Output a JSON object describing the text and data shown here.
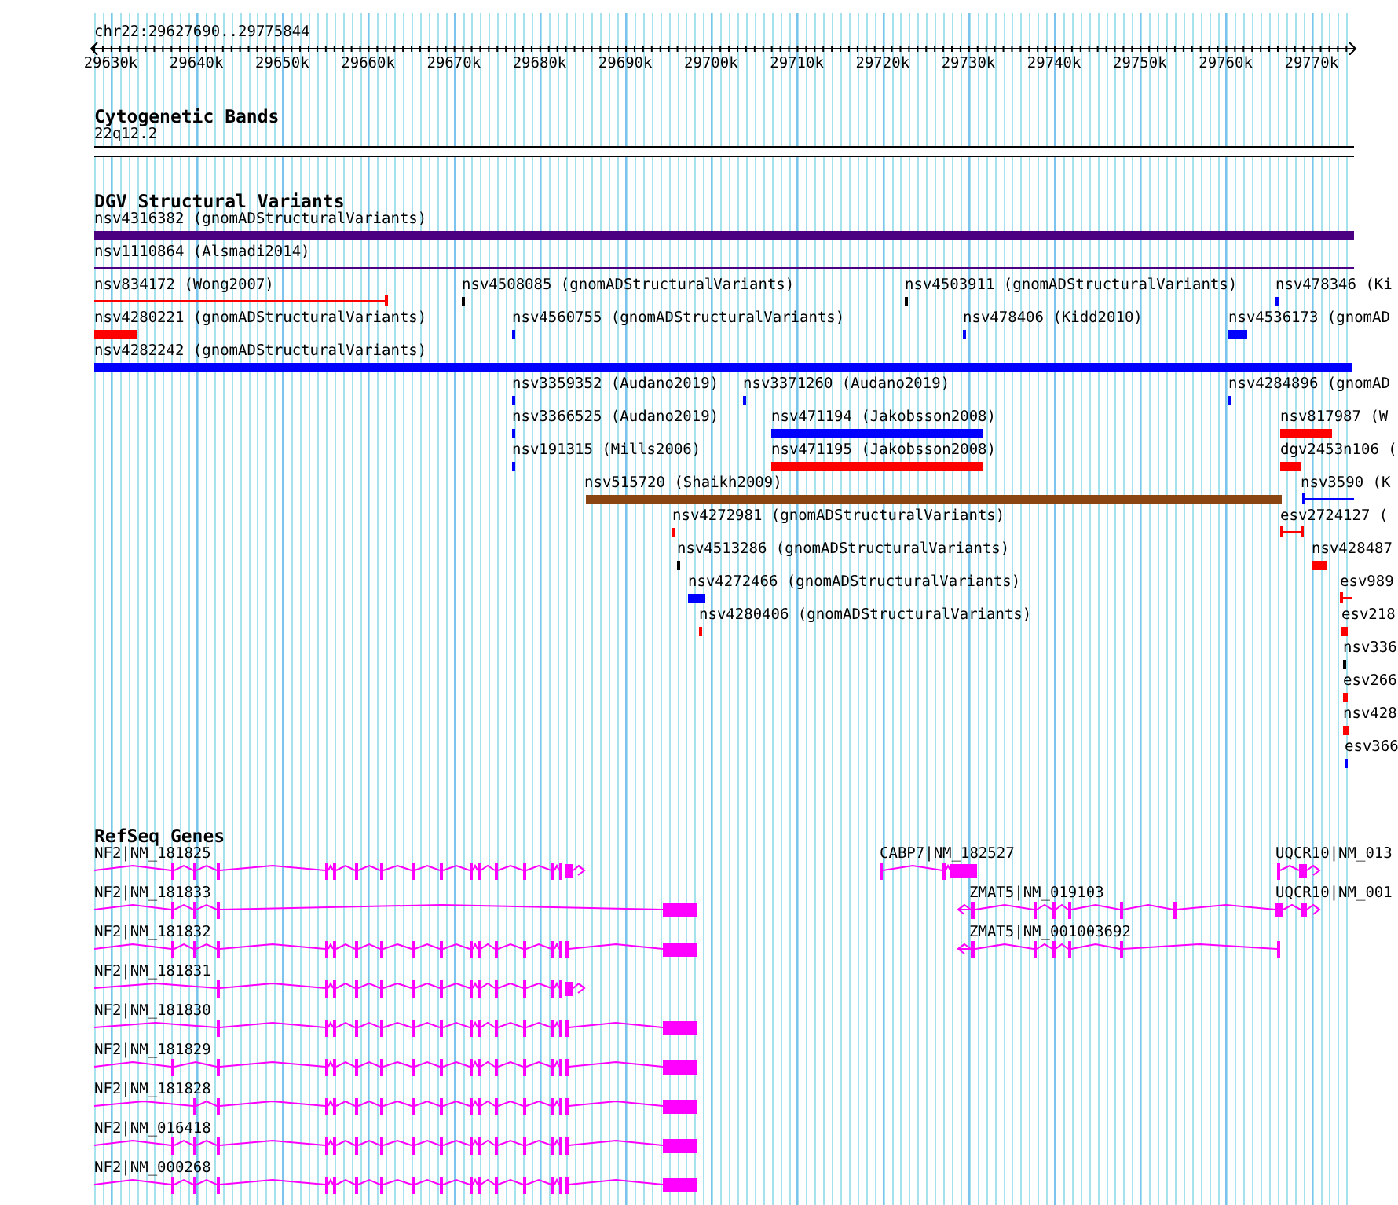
{
  "ruler": {
    "location": "chr22:29627690..29775844",
    "ticks": [
      "29630k",
      "29640k",
      "29650k",
      "29660k",
      "29670k",
      "29680k",
      "29690k",
      "29700k",
      "29710k",
      "29720k",
      "29730k",
      "29740k",
      "29750k",
      "29760k",
      "29770k"
    ]
  },
  "tracks": [
    {
      "kind": "bands",
      "title": "Cytogenetic Bands",
      "features": [
        {
          "label": "22q12.2"
        }
      ]
    },
    {
      "kind": "variants",
      "title": "DGV Structural Variants",
      "features": [
        {
          "label": "nsv4316382 (gnomADStructuralVariants)",
          "color": "#4b0082",
          "kind": "bar"
        },
        {
          "label": "nsv1110864 (Alsmadi2014)",
          "color": "#4b0082",
          "kind": "line"
        },
        {
          "label": "nsv834172 (Wong2007)",
          "color": "#ff0000",
          "kind": "line"
        },
        {
          "label": "nsv4508085 (gnomADStructuralVariants)",
          "color": "#000000",
          "kind": "bar"
        },
        {
          "label": "nsv4503911 (gnomADStructuralVariants)",
          "color": "#000000",
          "kind": "bar"
        },
        {
          "label": "nsv478346 (Ki",
          "color": "#0000ff",
          "kind": "bar"
        },
        {
          "label": "nsv4280221 (gnomADStructuralVariants)",
          "color": "#ff0000",
          "kind": "bar"
        },
        {
          "label": "nsv4560755 (gnomADStructuralVariants)",
          "color": "#0000ff",
          "kind": "bar"
        },
        {
          "label": "nsv478406 (Kidd2010)",
          "color": "#0000ff",
          "kind": "bar"
        },
        {
          "label": "nsv4536173 (gnomAD",
          "color": "#0000ff",
          "kind": "bar"
        },
        {
          "label": "nsv4282242 (gnomADStructuralVariants)",
          "color": "#0000ff",
          "kind": "bar"
        },
        {
          "label": "nsv3359352 (Audano2019)",
          "color": "#0000ff",
          "kind": "bar"
        },
        {
          "label": "nsv3371260 (Audano2019)",
          "color": "#0000ff",
          "kind": "bar"
        },
        {
          "label": "nsv4284896 (gnomAD",
          "color": "#0000ff",
          "kind": "bar"
        },
        {
          "label": "nsv3366525 (Audano2019)",
          "color": "#0000ff",
          "kind": "bar"
        },
        {
          "label": "nsv471194 (Jakobsson2008)",
          "color": "#0000ff",
          "kind": "bar"
        },
        {
          "label": "nsv817987 (W",
          "color": "#ff0000",
          "kind": "bar"
        },
        {
          "label": "nsv191315 (Mills2006)",
          "color": "#0000ff",
          "kind": "bar"
        },
        {
          "label": "nsv471195 (Jakobsson2008)",
          "color": "#ff0000",
          "kind": "bar"
        },
        {
          "label": "dgv2453n106 (",
          "color": "#ff0000",
          "kind": "bar"
        },
        {
          "label": "nsv515720 (Shaikh2009)",
          "color": "#8b4513",
          "kind": "bar"
        },
        {
          "label": "nsv3590 (K",
          "color": "#0000ff",
          "kind": "line"
        },
        {
          "label": "nsv4272981 (gnomADStructuralVariants)",
          "color": "#ff0000",
          "kind": "bar"
        },
        {
          "label": "esv2724127 (",
          "color": "#ff0000",
          "kind": "line"
        },
        {
          "label": "nsv4513286 (gnomADStructuralVariants)",
          "color": "#000000",
          "kind": "bar"
        },
        {
          "label": "nsv428487",
          "color": "#ff0000",
          "kind": "bar"
        },
        {
          "label": "nsv4272466 (gnomADStructuralVariants)",
          "color": "#0000ff",
          "kind": "bar"
        },
        {
          "label": "esv989",
          "color": "#ff0000",
          "kind": "line"
        },
        {
          "label": "nsv4280406 (gnomADStructuralVariants)",
          "color": "#ff0000",
          "kind": "bar"
        },
        {
          "label": "esv218",
          "color": "#ff0000",
          "kind": "bar"
        },
        {
          "label": "nsv336",
          "color": "#000000",
          "kind": "bar"
        },
        {
          "label": "esv266",
          "color": "#ff0000",
          "kind": "bar"
        },
        {
          "label": "nsv428",
          "color": "#ff0000",
          "kind": "bar"
        },
        {
          "label": "esv366",
          "color": "#0000ff",
          "kind": "bar"
        }
      ]
    },
    {
      "kind": "genes",
      "title": "RefSeq Genes",
      "features": [
        {
          "label": "NF2|NM_181825"
        },
        {
          "label": "CABP7|NM_182527"
        },
        {
          "label": "UQCR10|NM_013"
        },
        {
          "label": "NF2|NM_181833"
        },
        {
          "label": "ZMAT5|NM_019103"
        },
        {
          "label": "UQCR10|NM_001"
        },
        {
          "label": "NF2|NM_181832"
        },
        {
          "label": "ZMAT5|NM_001003692"
        },
        {
          "label": "NF2|NM_181831"
        },
        {
          "label": "NF2|NM_181830"
        },
        {
          "label": "NF2|NM_181829"
        },
        {
          "label": "NF2|NM_181828"
        },
        {
          "label": "NF2|NM_016418"
        },
        {
          "label": "NF2|NM_000268"
        }
      ]
    }
  ]
}
